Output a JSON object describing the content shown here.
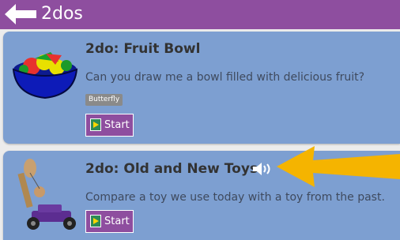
{
  "header": {
    "title": "2dos",
    "back_icon": "left-arrow-icon"
  },
  "cards": [
    {
      "title": "2do: Fruit Bowl",
      "description": "Can you draw me a bowl filled with delicious fruit?",
      "tag": "Butterfly",
      "start_label": "Start",
      "thumbnail": "fruit-bowl-image"
    },
    {
      "title": "2do: Old and New Toys",
      "description": "Compare a toy we use today with a toy from the past.",
      "start_label": "Start",
      "thumbnail": "toys-image",
      "audio_icon": "speaker-icon"
    }
  ],
  "colors": {
    "header_bg": "#8e4e9f",
    "card_bg": "#7d9fd1",
    "button_bg": "#8e4e9f",
    "annotation_arrow": "#f5b400"
  }
}
